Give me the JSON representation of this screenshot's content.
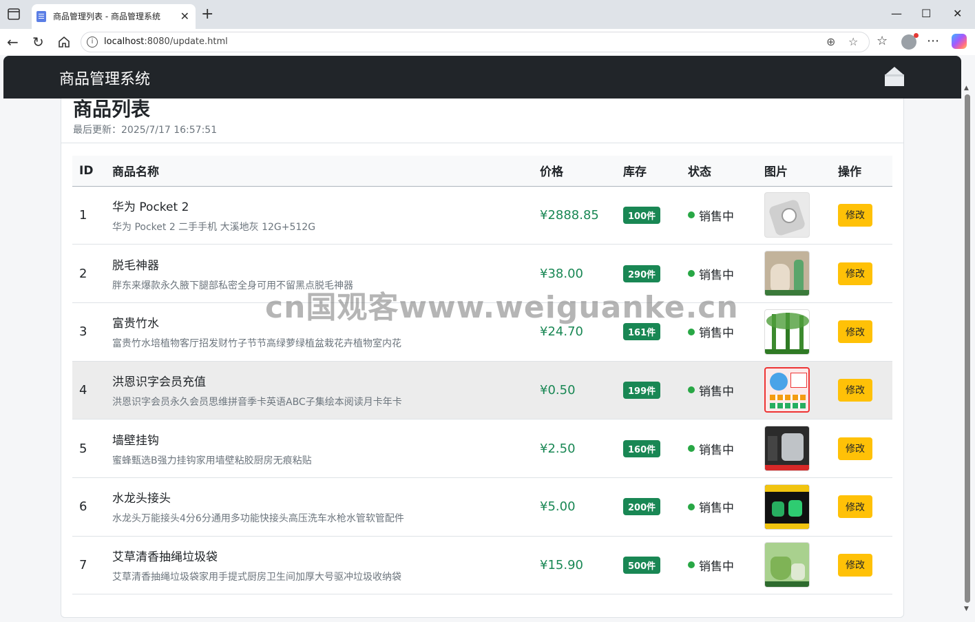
{
  "browser": {
    "tab_title": "商品管理列表 - 商品管理系统",
    "url_host": "localhost",
    "url_rest": ":8080/update.html"
  },
  "app": {
    "brand": "商品管理系统",
    "page_title": "商品列表",
    "last_updated": "最后更新：2025/7/17 16:57:51"
  },
  "table": {
    "headers": [
      "ID",
      "商品名称",
      "价格",
      "库存",
      "状态",
      "图片",
      "操作"
    ],
    "rows": [
      {
        "id": "1",
        "name": "华为 Pocket 2",
        "desc": "华为 Pocket 2 二手手机 大溪地灰 12G+512G",
        "price": "¥2888.85",
        "stock": "100件",
        "status": "销售中",
        "action": "修改",
        "thumb_color": "#e9e9e9"
      },
      {
        "id": "2",
        "name": "脱毛神器",
        "desc": "胖东来爆款永久腋下腿部私密全身可用不留黑点脱毛神器",
        "price": "¥38.00",
        "stock": "290件",
        "status": "销售中",
        "action": "修改",
        "thumb_color": "#b7a48a"
      },
      {
        "id": "3",
        "name": "富贵竹水",
        "desc": "富贵竹水培植物客厅招发财竹子节节高绿萝绿植盆栽花卉植物室内花",
        "price": "¥24.70",
        "stock": "161件",
        "status": "销售中",
        "action": "修改",
        "thumb_color": "#3c8a2e"
      },
      {
        "id": "4",
        "name": "洪恩识字会员充值",
        "desc": "洪恩识字会员永久会员思维拼音季卡英语ABC子集绘本阅读月卡年卡",
        "price": "¥0.50",
        "stock": "199件",
        "status": "销售中",
        "action": "修改",
        "thumb_color": "#f2f2f2"
      },
      {
        "id": "5",
        "name": "墙壁挂钩",
        "desc": "蜜蜂甄选B强力挂钩家用墙壁粘胶厨房无痕粘贴",
        "price": "¥2.50",
        "stock": "160件",
        "status": "销售中",
        "action": "修改",
        "thumb_color": "#2b2b2b"
      },
      {
        "id": "6",
        "name": "水龙头接头",
        "desc": "水龙头万能接头4分6分通用多功能快接头高压洗车水枪水管软管配件",
        "price": "¥5.00",
        "stock": "200件",
        "status": "销售中",
        "action": "修改",
        "thumb_color": "#1a1a1a"
      },
      {
        "id": "7",
        "name": "艾草清香抽绳垃圾袋",
        "desc": "艾草清香抽绳垃圾袋家用手提式厨房卫生间加厚大号驱冲垃圾收纳袋",
        "price": "¥15.90",
        "stock": "500件",
        "status": "销售中",
        "action": "修改",
        "thumb_color": "#8fbf6a"
      }
    ]
  },
  "watermark": "cn国观客www.weiguanke.cn"
}
